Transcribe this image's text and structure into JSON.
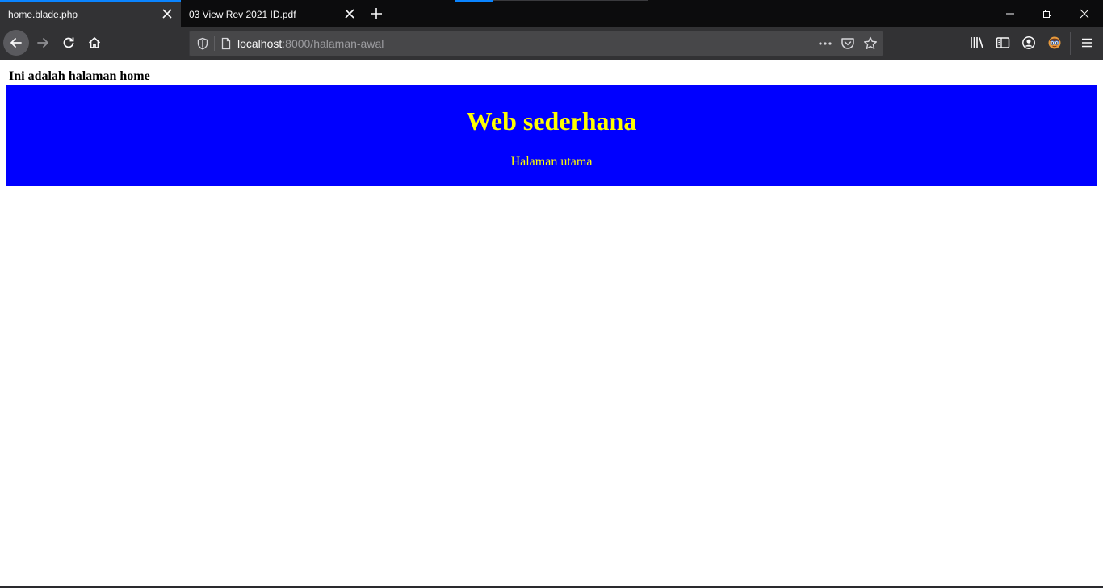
{
  "tabs": [
    {
      "title": "home.blade.php",
      "active": true
    },
    {
      "title": "03 View Rev 2021 ID.pdf",
      "active": false
    }
  ],
  "urlbar": {
    "host": "localhost",
    "path": ":8000/halaman-awal"
  },
  "icons": {
    "back": "arrow-left-icon",
    "forward": "arrow-right-icon",
    "reload": "reload-icon",
    "home": "home-icon",
    "shield": "tracking-shield-icon",
    "page": "page-icon",
    "more": "more-dots-icon",
    "pocket": "pocket-icon",
    "star": "bookmark-star-icon",
    "library": "library-icon",
    "sidebar": "sidebar-icon",
    "account": "account-icon",
    "extension": "extension-avatar-icon",
    "menu": "hamburger-menu-icon"
  },
  "page": {
    "heading": "Ini adalah halaman home",
    "banner": {
      "title": "Web sederhana",
      "subtitle": "Halaman utama"
    }
  },
  "colors": {
    "banner_bg": "#0000ff",
    "banner_text": "#ffff00",
    "chrome_dark": "#0c0c0d",
    "toolbar": "#323234",
    "accent": "#0a84ff"
  }
}
